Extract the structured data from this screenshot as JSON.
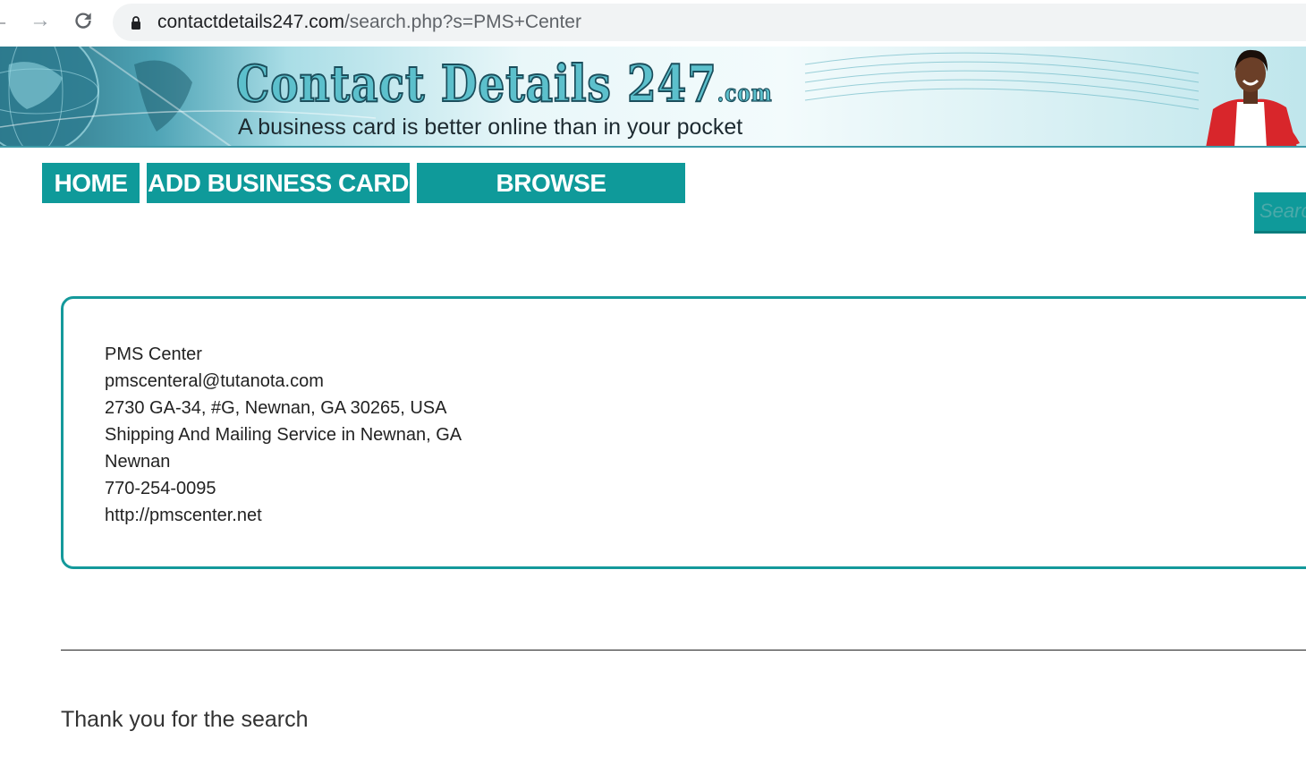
{
  "browser": {
    "url_host": "contactdetails247.com",
    "url_path": "/search.php?s=PMS+Center"
  },
  "banner": {
    "logo_main": "Contact Details 247",
    "logo_suffix": ".com",
    "tagline": "A business card is better online than in your pocket"
  },
  "nav": {
    "home": "HOME",
    "add_business_card": "ADD BUSINESS CARD",
    "browse": "BROWSE"
  },
  "search": {
    "placeholder": "Search"
  },
  "card": {
    "lines": [
      "PMS Center",
      "pmscenteral@tutanota.com",
      "2730 GA-34, #G, Newnan, GA 30265, USA",
      "Shipping And Mailing Service in Newnan, GA",
      "Newnan",
      "770-254-0095",
      "http://pmscenter.net"
    ]
  },
  "footer": {
    "thanks": "Thank you for the search"
  },
  "colors": {
    "accent": "#0f9a9a",
    "card_border": "#14999b"
  }
}
